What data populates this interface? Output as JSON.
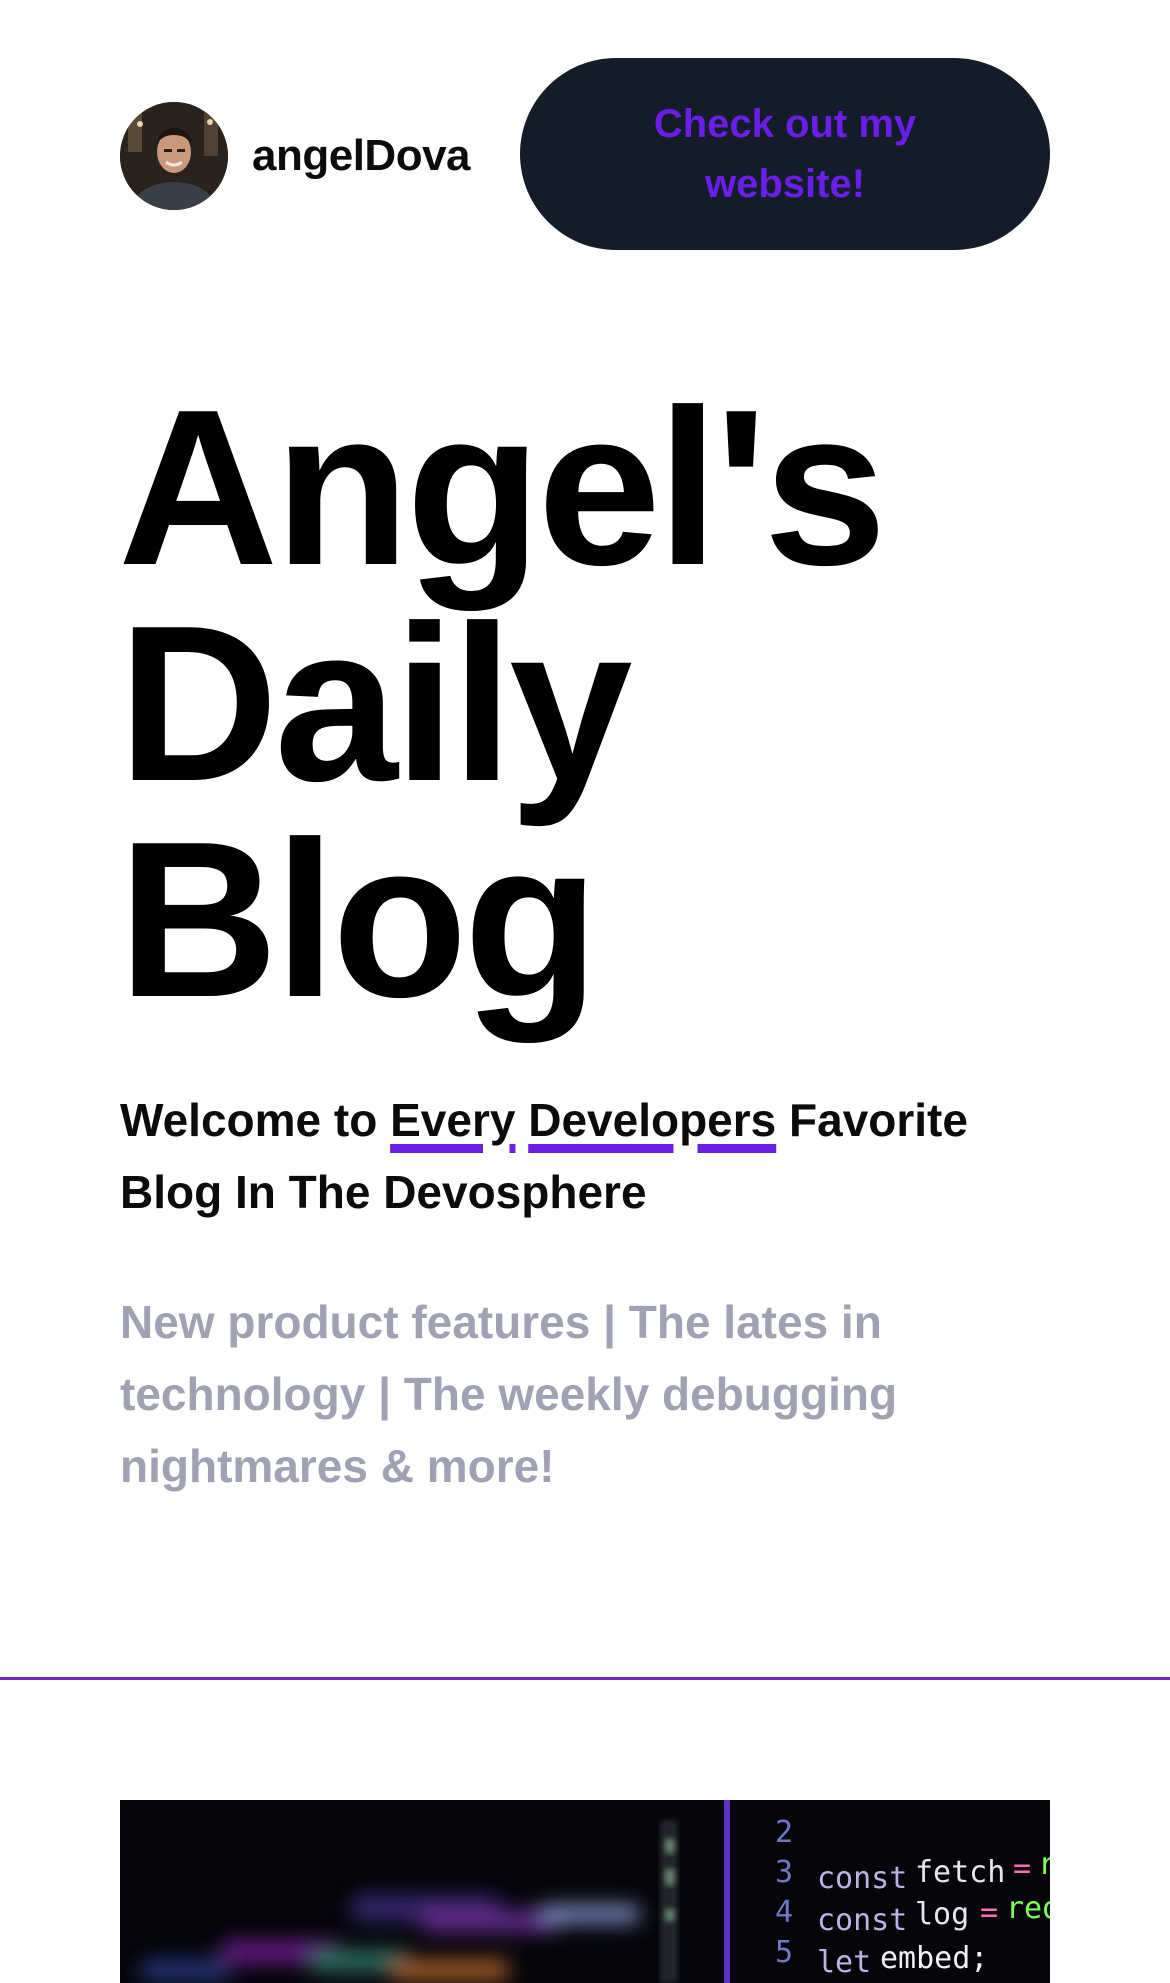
{
  "header": {
    "author_name": "angelDova",
    "cta_label": "Check out my website!"
  },
  "hero": {
    "title_lines": [
      "Angel's",
      "Daily",
      "Blog"
    ],
    "welcome": {
      "before": "Welcome to ",
      "underlined_1": "Every",
      "middle_1": " ",
      "underlined_2": "Developers",
      "after": " Favorite Blog In The Devosphere"
    },
    "tagline": "New product features | The lates in technology | The weekly debugging nightmares & more!"
  },
  "post_image": {
    "code_lines": [
      {
        "number": "2",
        "text": ""
      },
      {
        "number": "3",
        "keyword": "const",
        "name": "fetch",
        "op": "=",
        "value": "requi"
      },
      {
        "number": "4",
        "keyword": "const",
        "name": "log",
        "op": "=",
        "value": "requir"
      },
      {
        "number": "5",
        "keyword": "let",
        "name": "embed;",
        "op": "",
        "value": ""
      }
    ]
  },
  "colors": {
    "accent": "#6a1ee6",
    "cta_bg": "#141b29",
    "tagline": "#a0a1b3",
    "divider": "#6a2bc9"
  },
  "icons": {
    "avatar": "author-avatar-photo"
  }
}
